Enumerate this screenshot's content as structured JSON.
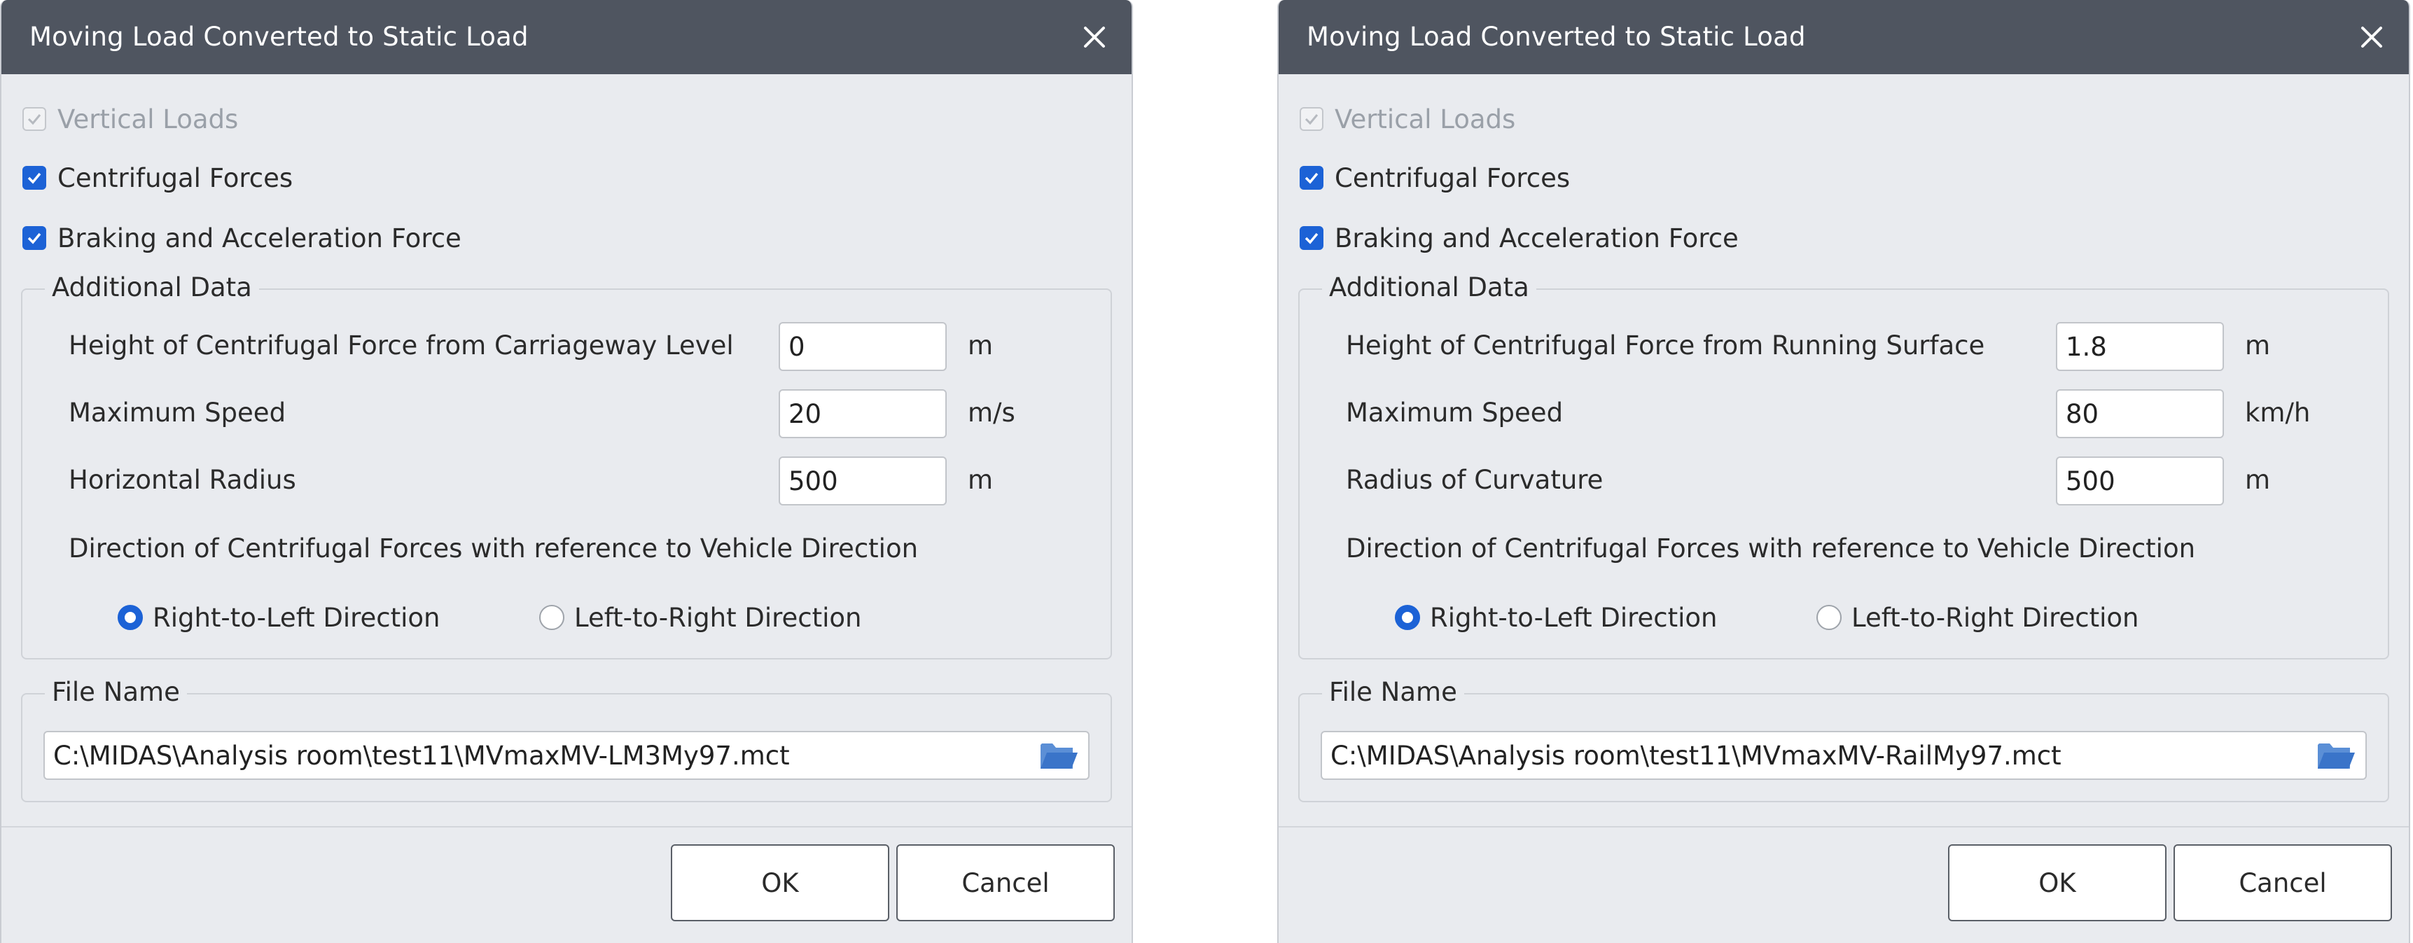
{
  "dialogs": [
    {
      "title": "Moving Load Converted to Static Load",
      "vertical_loads": {
        "label": "Vertical Loads",
        "checked": true,
        "disabled": true
      },
      "centrifugal_forces": {
        "label": "Centrifugal Forces",
        "checked": true
      },
      "braking_force": {
        "label": "Braking and Acceleration Force",
        "checked": true
      },
      "additional_data": {
        "title": "Additional Data",
        "height": {
          "label": "Height of Centrifugal Force from Carriageway Level",
          "value": "0",
          "unit": "m"
        },
        "speed": {
          "label": "Maximum Speed",
          "value": "20",
          "unit": "m/s"
        },
        "radius": {
          "label": "Horizontal Radius",
          "value": "500",
          "unit": "m"
        },
        "direction_label": "Direction of Centrifugal Forces with reference to Vehicle Direction",
        "direction_options": [
          {
            "label": "Right-to-Left Direction",
            "selected": true
          },
          {
            "label": "Left-to-Right Direction",
            "selected": false
          }
        ]
      },
      "file": {
        "title": "File Name",
        "value": "C:\\MIDAS\\Analysis room\\test11\\MVmaxMV-LM3My97.mct"
      },
      "buttons": {
        "ok": "OK",
        "cancel": "Cancel"
      }
    },
    {
      "title": "Moving Load Converted to Static Load",
      "vertical_loads": {
        "label": "Vertical Loads",
        "checked": true,
        "disabled": true
      },
      "centrifugal_forces": {
        "label": "Centrifugal Forces",
        "checked": true
      },
      "braking_force": {
        "label": "Braking and Acceleration Force",
        "checked": true
      },
      "additional_data": {
        "title": "Additional Data",
        "height": {
          "label": "Height of Centrifugal Force from Running Surface",
          "value": "1.8",
          "unit": "m"
        },
        "speed": {
          "label": "Maximum Speed",
          "value": "80",
          "unit": "km/h"
        },
        "radius": {
          "label": "Radius of Curvature",
          "value": "500",
          "unit": "m"
        },
        "direction_label": "Direction of Centrifugal Forces with reference to Vehicle Direction",
        "direction_options": [
          {
            "label": "Right-to-Left Direction",
            "selected": true
          },
          {
            "label": "Left-to-Right Direction",
            "selected": false
          }
        ]
      },
      "file": {
        "title": "File Name",
        "value": "C:\\MIDAS\\Analysis room\\test11\\MVmaxMV-RailMy97.mct"
      },
      "buttons": {
        "ok": "OK",
        "cancel": "Cancel"
      }
    }
  ],
  "colors": {
    "titlebar": "#4f5560",
    "dialog_bg": "#e9ebef",
    "accent": "#1c62d6"
  },
  "icons": [
    "close-icon",
    "checkmark-icon",
    "folder-icon"
  ]
}
